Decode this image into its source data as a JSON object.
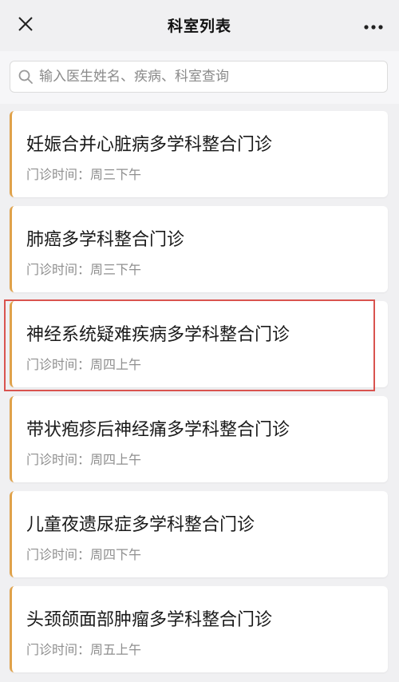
{
  "header": {
    "title": "科室列表",
    "close_icon": "close-icon",
    "more_icon": "more-icon"
  },
  "search": {
    "placeholder": "输入医生姓名、疾病、科室查询",
    "icon": "search-icon"
  },
  "colors": {
    "accent_bar": "#e0a24a",
    "highlight_frame": "#d9534f",
    "background": "#f0f0f2"
  },
  "clinics": [
    {
      "name": "妊娠合并心脏病多学科整合门诊",
      "time": "门诊时间：周三下午"
    },
    {
      "name": "肺癌多学科整合门诊",
      "time": "门诊时间：周三下午"
    },
    {
      "name": "神经系统疑难疾病多学科整合门诊",
      "time": "门诊时间：周四上午",
      "highlighted": true
    },
    {
      "name": "带状疱疹后神经痛多学科整合门诊",
      "time": "门诊时间：周四上午"
    },
    {
      "name": "儿童夜遗尿症多学科整合门诊",
      "time": "门诊时间：周四下午"
    },
    {
      "name": "头颈颌面部肿瘤多学科整合门诊",
      "time": "门诊时间：周五上午"
    }
  ]
}
